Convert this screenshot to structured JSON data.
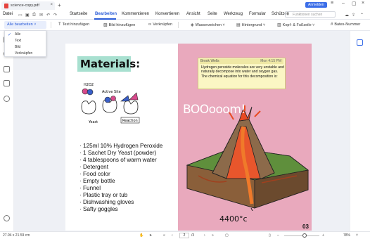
{
  "titlebar": {
    "tab_title": "science-copy.pdf",
    "close": "×",
    "add": "+",
    "login": "Anmelden"
  },
  "menu": {
    "file": "Datei",
    "items": [
      "Startseite",
      "Bearbeiten",
      "Kommentieren",
      "Konvertieren",
      "Ansicht",
      "Seite",
      "Werkzeug",
      "Formular",
      "Schützen"
    ],
    "active": "Bearbeiten",
    "search_placeholder": "Funktionen suchen"
  },
  "toolbar": {
    "edit_all": "Alle bearbeiten",
    "add_text": "Text hinzufügen",
    "add_image": "Bild hinzufügen",
    "link": "Verknüpfen",
    "watermark": "Wasserzeichen",
    "background": "Hintergrund",
    "header_footer": "Kopf- & Fußzeile",
    "bates": "Bates-Nummer"
  },
  "dropdown": {
    "items": [
      "Alle",
      "Text",
      "Bild",
      "Verknüpfen"
    ],
    "selected": "Alle"
  },
  "document": {
    "materials_title": "Materials:",
    "sketch_labels": {
      "h2o2": "H2O2",
      "active_site": "Active Site",
      "yeast": "Yeast",
      "reaction": "Reaction"
    },
    "list": [
      "125ml 10% Hydrogen Peroxide",
      "1 Sachet Dry Yeast (powder)",
      "4 tablespoons of warm water",
      "Detergent",
      "Food color",
      "Empty bottle",
      "Funnel",
      "Plastic tray or tub",
      "Dishwashing gloves",
      "Safty goggles"
    ],
    "comment": {
      "author": "Brook Wells",
      "time": "Mon 4:15 PM",
      "body": "Hydrogen peroxide molecules are very unstable and naturally decompose into water and oxygen gas. The chemical equation for this decomposition is:"
    },
    "boom_text": "BOOooom!",
    "temperature": "4400°c",
    "page_number": "03"
  },
  "statusbar": {
    "dimensions": "27.94 x 21.59 cm",
    "page_current": "2",
    "page_total": "/3",
    "zoom": "78%"
  },
  "colors": {
    "accent": "#2a5bd7",
    "materials_bg": "#a8e0d0",
    "page_pink": "#e9a9bd",
    "comment_bg": "#fbf6c4"
  }
}
